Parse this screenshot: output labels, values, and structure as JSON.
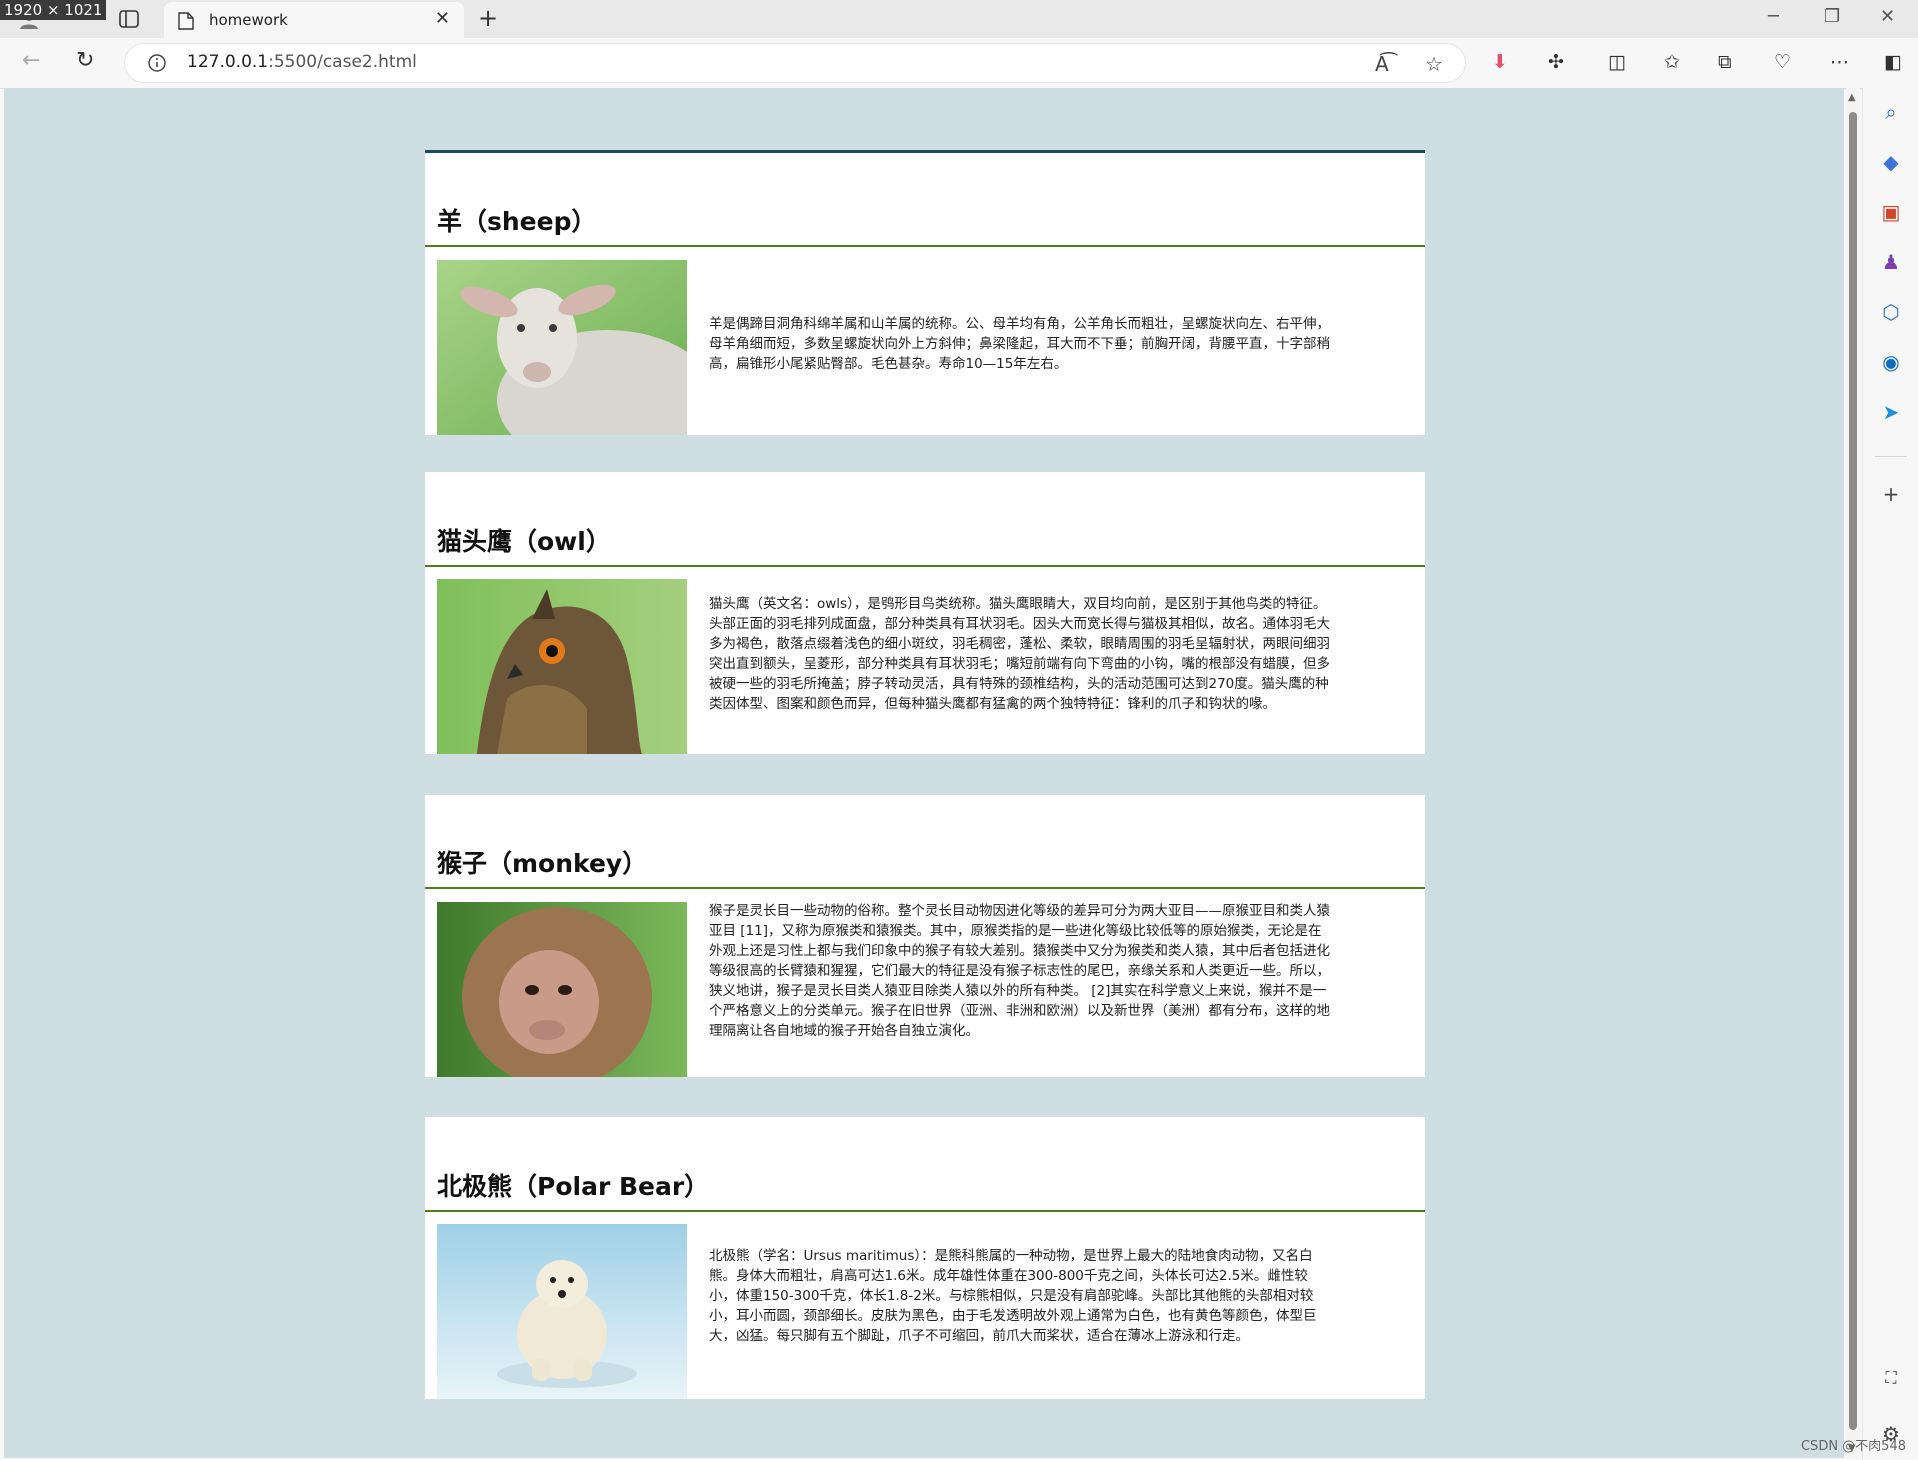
{
  "screen_badge": "1920 × 1021",
  "tab": {
    "title": "homework"
  },
  "address": {
    "host": "127.0.0.1",
    "path": ":5500/case2.html"
  },
  "sections": [
    {
      "title": "羊（sheep）",
      "photo": "sheep",
      "text": "羊是偶蹄目洞角科绵羊属和山羊属的统称。公、母羊均有角，公羊角长而粗壮，呈螺旋状向左、右平伸，母羊角细而短，多数呈螺旋状向外上方斜伸；鼻梁隆起，耳大而不下垂；前胸开阔，背腰平直，十字部稍高，扁锥形小尾紧贴臀部。毛色甚杂。寿命10—15年左右。"
    },
    {
      "title": "猫头鹰（owl）",
      "photo": "owl",
      "text": "猫头鹰（英文名：owls），是鸮形目鸟类统称。猫头鹰眼睛大，双目均向前，是区别于其他鸟类的特征。头部正面的羽毛排列成面盘，部分种类具有耳状羽毛。因头大而宽长得与猫极其相似，故名。通体羽毛大多为褐色，散落点缀着浅色的细小斑纹，羽毛稠密，蓬松、柔软，眼睛周围的羽毛呈辐射状，两眼间细羽突出直到额头，呈菱形，部分种类具有耳状羽毛；嘴短前端有向下弯曲的小钩，嘴的根部没有蜡膜，但多被硬一些的羽毛所掩盖；脖子转动灵活，具有特殊的颈椎结构，头的活动范围可达到270度。猫头鹰的种类因体型、图案和颜色而异，但每种猫头鹰都有猛禽的两个独特特征：锋利的爪子和钩状的喙。"
    },
    {
      "title": "猴子（monkey）",
      "photo": "monkey",
      "text": "猴子是灵长目一些动物的俗称。整个灵长目动物因进化等级的差异可分为两大亚目——原猴亚目和类人猿亚目 [11]，又称为原猴类和猿猴类。其中，原猴类指的是一些进化等级比较低等的原始猴类，无论是在外观上还是习性上都与我们印象中的猴子有较大差别。猿猴类中又分为猴类和类人猿，其中后者包括进化等级很高的长臂猿和猩猩，它们最大的特征是没有猴子标志性的尾巴，亲缘关系和人类更近一些。所以，狭义地讲，猴子是灵长目类人猿亚目除类人猿以外的所有种类。 [2]其实在科学意义上来说，猴并不是一个严格意义上的分类单元。猴子在旧世界（亚洲、非洲和欧洲）以及新世界（美洲）都有分布，这样的地理隔离让各自地域的猴子开始各自独立演化。"
    },
    {
      "title": "北极熊（Polar Bear）",
      "photo": "polar-bear",
      "text": "北极熊（学名：Ursus maritimus）：是熊科熊属的一种动物，是世界上最大的陆地食肉动物，又名白熊。身体大而粗壮，肩高可达1.6米。成年雄性体重在300-800千克之间，头体长可达2.5米。雌性较小，体重150-300千克，体长1.8-2米。与棕熊相似，只是没有肩部驼峰。头部比其他熊的头部相对较小，耳小而圆，颈部细长。皮肤为黑色，由于毛发透明故外观上通常为白色，也有黄色等颜色，体型巨大，凶猛。每只脚有五个脚趾，爪子不可缩回，前爪大而桨状，适合在薄冰上游泳和行走。"
    }
  ],
  "watermark": "CSDN @不肉548",
  "colors": {
    "page_bg": "#cfdee3",
    "card_top_border": "#1b4c5c",
    "heading_rule": "#4f7f1c"
  }
}
